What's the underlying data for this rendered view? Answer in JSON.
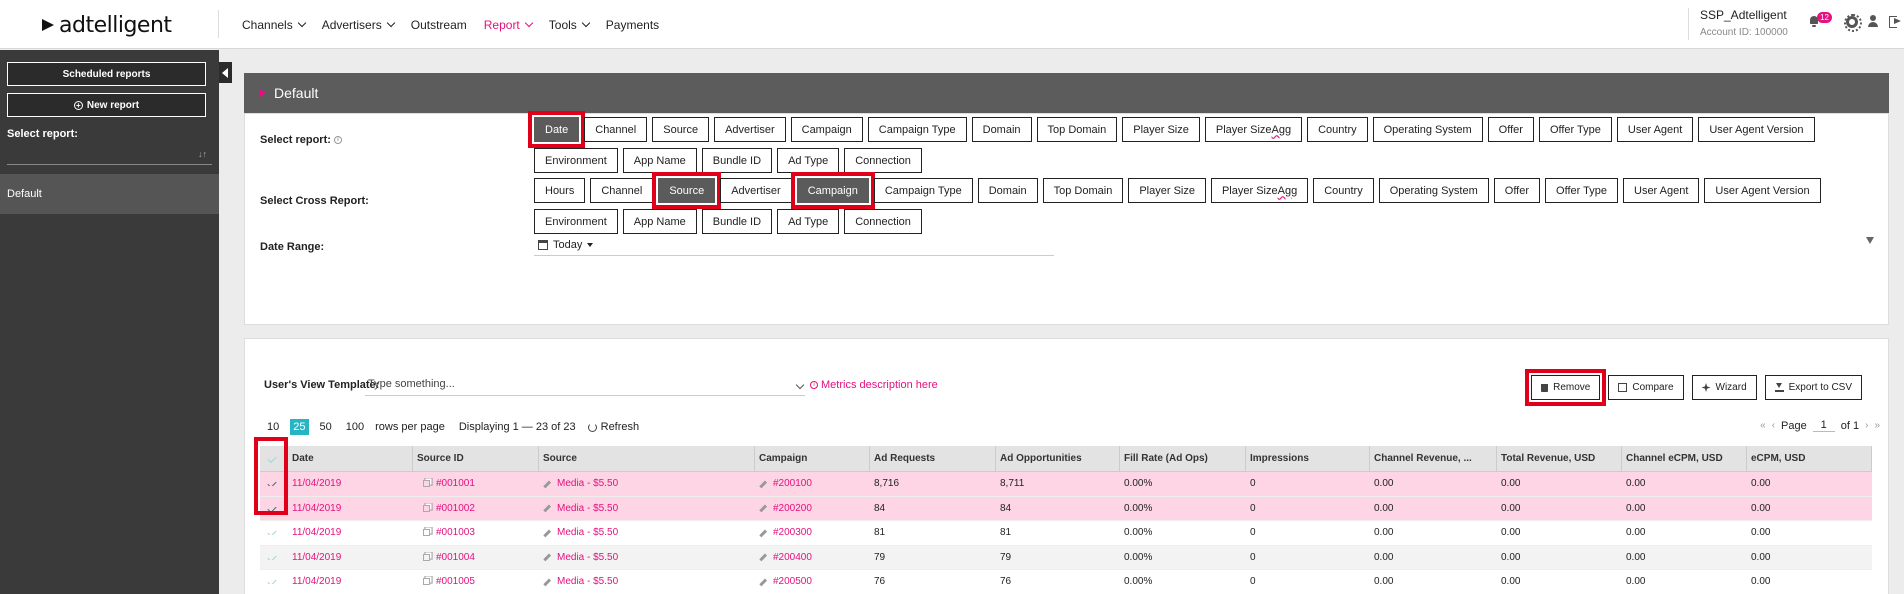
{
  "brand": {
    "name": "adtelligent",
    "accent": "#e4117f",
    "teal": "#26b5c5",
    "highlight": "#e0001a"
  },
  "nav": {
    "items": [
      {
        "label": "Channels",
        "dropdown": true,
        "active": false
      },
      {
        "label": "Advertisers",
        "dropdown": true,
        "active": false
      },
      {
        "label": "Outstream",
        "dropdown": false,
        "active": false
      },
      {
        "label": "Report",
        "dropdown": true,
        "active": true
      },
      {
        "label": "Tools",
        "dropdown": true,
        "active": false
      },
      {
        "label": "Payments",
        "dropdown": false,
        "active": false
      }
    ]
  },
  "account": {
    "name": "SSP_Adtelligent",
    "id_text": "Account ID: 100000",
    "notifications": "12"
  },
  "sidebar": {
    "scheduled_label": "Scheduled reports",
    "new_report_label": "New report",
    "select_report_label": "Select report:",
    "items": [
      "Default"
    ]
  },
  "panel": {
    "title": "Default",
    "select_report_label": "Select report:",
    "cross_report_label": "Select Cross Report:",
    "date_range_label": "Date Range:",
    "date_range_value": "Today",
    "report_chips": [
      "Date",
      "Channel",
      "Source",
      "Advertiser",
      "Campaign",
      "Campaign Type",
      "Domain",
      "Top Domain",
      "Player Size",
      "Player Size Agg",
      "Country",
      "Operating System",
      "Offer",
      "Offer Type",
      "User Agent",
      "User Agent Version",
      "Environment",
      "App Name",
      "Bundle ID",
      "Ad Type",
      "Connection"
    ],
    "report_selected": [
      "Date"
    ],
    "cross_chips": [
      "Hours",
      "Channel",
      "Source",
      "Advertiser",
      "Campaign",
      "Campaign Type",
      "Domain",
      "Top Domain",
      "Player Size",
      "Player Size Agg",
      "Country",
      "Operating System",
      "Offer",
      "Offer Type",
      "User Agent",
      "User Agent Version",
      "Environment",
      "App Name",
      "Bundle ID",
      "Ad Type",
      "Connection"
    ],
    "cross_selected": [
      "Source",
      "Campaign"
    ]
  },
  "results": {
    "template_label": "User's View Template:",
    "template_placeholder": "Type something...",
    "metrics_link": "Metrics description here",
    "buttons": {
      "remove": "Remove",
      "compare": "Compare",
      "wizard": "Wizard",
      "export": "Export to CSV"
    },
    "page_sizes": [
      "10",
      "25",
      "50",
      "100"
    ],
    "page_size_selected": "25",
    "rows_per_page": "rows per page",
    "displaying": "Displaying 1 — 23 of 23",
    "refresh": "Refresh",
    "page_label": "Page",
    "page_value": "1",
    "of_label": "of 1"
  },
  "table": {
    "headers": [
      "Date",
      "Source ID",
      "Source",
      "Campaign",
      "Ad Requests",
      "Ad Opportunities",
      "Fill Rate (Ad Ops)",
      "Impressions",
      "Channel Revenue, ...",
      "Total Revenue, USD",
      "Channel eCPM, USD",
      "eCPM, USD"
    ],
    "rows": [
      {
        "checked": true,
        "date": "11/04/2019",
        "source_id": "#001001",
        "source": "Media - $5.50",
        "campaign": "#200100",
        "ad_requests": "8,716",
        "ad_opportunities": "8,711",
        "fill_rate": "0.00%",
        "impressions": "0",
        "channel_revenue": "0.00",
        "total_revenue": "0.00",
        "channel_ecpm": "0.00",
        "ecpm": "0.00"
      },
      {
        "checked": true,
        "date": "11/04/2019",
        "source_id": "#001002",
        "source": "Media - $5.50",
        "campaign": "#200200",
        "ad_requests": "84",
        "ad_opportunities": "84",
        "fill_rate": "0.00%",
        "impressions": "0",
        "channel_revenue": "0.00",
        "total_revenue": "0.00",
        "channel_ecpm": "0.00",
        "ecpm": "0.00"
      },
      {
        "checked": false,
        "date": "11/04/2019",
        "source_id": "#001003",
        "source": "Media - $5.50",
        "campaign": "#200300",
        "ad_requests": "81",
        "ad_opportunities": "81",
        "fill_rate": "0.00%",
        "impressions": "0",
        "channel_revenue": "0.00",
        "total_revenue": "0.00",
        "channel_ecpm": "0.00",
        "ecpm": "0.00"
      },
      {
        "checked": false,
        "date": "11/04/2019",
        "source_id": "#001004",
        "source": "Media - $5.50",
        "campaign": "#200400",
        "ad_requests": "79",
        "ad_opportunities": "79",
        "fill_rate": "0.00%",
        "impressions": "0",
        "channel_revenue": "0.00",
        "total_revenue": "0.00",
        "channel_ecpm": "0.00",
        "ecpm": "0.00"
      },
      {
        "checked": false,
        "date": "11/04/2019",
        "source_id": "#001005",
        "source": "Media - $5.50",
        "campaign": "#200500",
        "ad_requests": "76",
        "ad_opportunities": "76",
        "fill_rate": "0.00%",
        "impressions": "0",
        "channel_revenue": "0.00",
        "total_revenue": "0.00",
        "channel_ecpm": "0.00",
        "ecpm": "0.00"
      }
    ]
  }
}
